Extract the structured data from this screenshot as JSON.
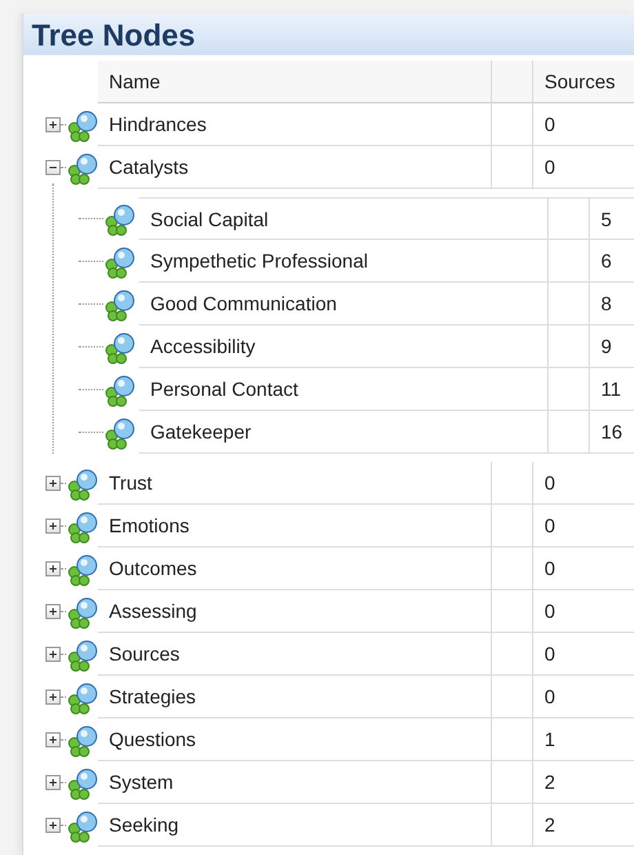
{
  "panel": {
    "title": "Tree Nodes"
  },
  "table": {
    "columns": [
      "Name",
      "Sources"
    ],
    "nodes": [
      {
        "name": "Hindrances",
        "sources": "0",
        "expanded": false
      },
      {
        "name": "Catalysts",
        "sources": "0",
        "expanded": true,
        "children": [
          {
            "name": "Social Capital",
            "sources": "5"
          },
          {
            "name": "Sympethetic Professional",
            "sources": "6"
          },
          {
            "name": "Good Communication",
            "sources": "8"
          },
          {
            "name": "Accessibility",
            "sources": "9"
          },
          {
            "name": "Personal Contact",
            "sources": "11"
          },
          {
            "name": "Gatekeeper",
            "sources": "16"
          }
        ]
      },
      {
        "name": "Trust",
        "sources": "0",
        "expanded": false
      },
      {
        "name": "Emotions",
        "sources": "0",
        "expanded": false
      },
      {
        "name": "Outcomes",
        "sources": "0",
        "expanded": false
      },
      {
        "name": "Assessing",
        "sources": "0",
        "expanded": false
      },
      {
        "name": "Sources",
        "sources": "0",
        "expanded": false
      },
      {
        "name": "Strategies",
        "sources": "0",
        "expanded": false
      },
      {
        "name": "Questions",
        "sources": "1",
        "expanded": false
      },
      {
        "name": "System",
        "sources": "2",
        "expanded": false
      },
      {
        "name": "Seeking",
        "sources": "2",
        "expanded": false
      }
    ]
  }
}
